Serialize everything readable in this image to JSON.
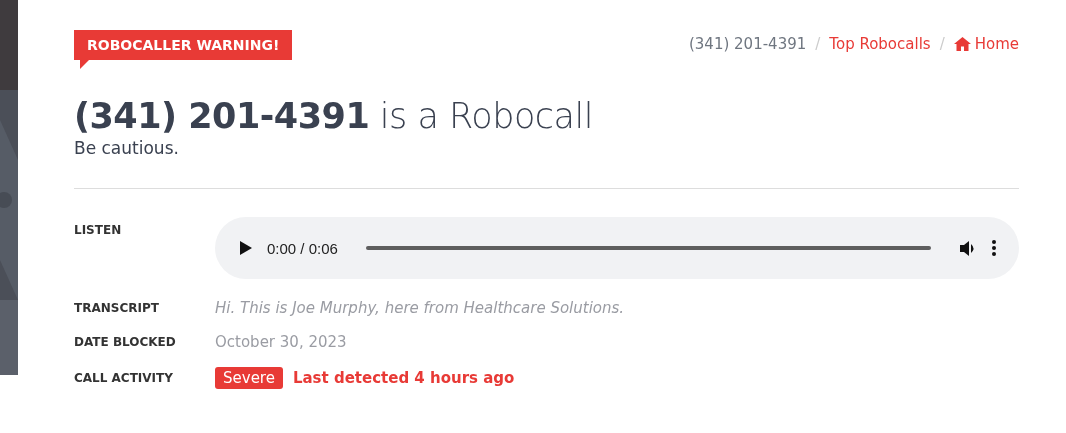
{
  "badge": "ROBOCALLER WARNING!",
  "breadcrumb": [
    {
      "label": "(341) 201-4391",
      "kind": "current"
    },
    {
      "separator": "/",
      "label": "Top Robocalls",
      "kind": "link"
    },
    {
      "separator": "/",
      "label": "Home",
      "kind": "home"
    }
  ],
  "heading": "**(341) 201-4391** is a Robocall",
  "subheading": "Be cautious.",
  "details": [
    {
      "label": "LISTEN",
      "kind": "audio",
      "time": "0:00 / 0:06",
      "level": 0
    },
    {
      "label": "TRANSCRIPT",
      "kind": "transcript",
      "value": "Hi. This is Joe Murphy, here from Healthcare Solutions."
    },
    {
      "label": "DATE BLOCKED",
      "kind": "text",
      "value": "October 30, 2023"
    },
    {
      "label": "CALL ACTIVITY",
      "kind": "activity",
      "severity": "Severe",
      "value": "Last detected 4 hours ago"
    }
  ]
}
